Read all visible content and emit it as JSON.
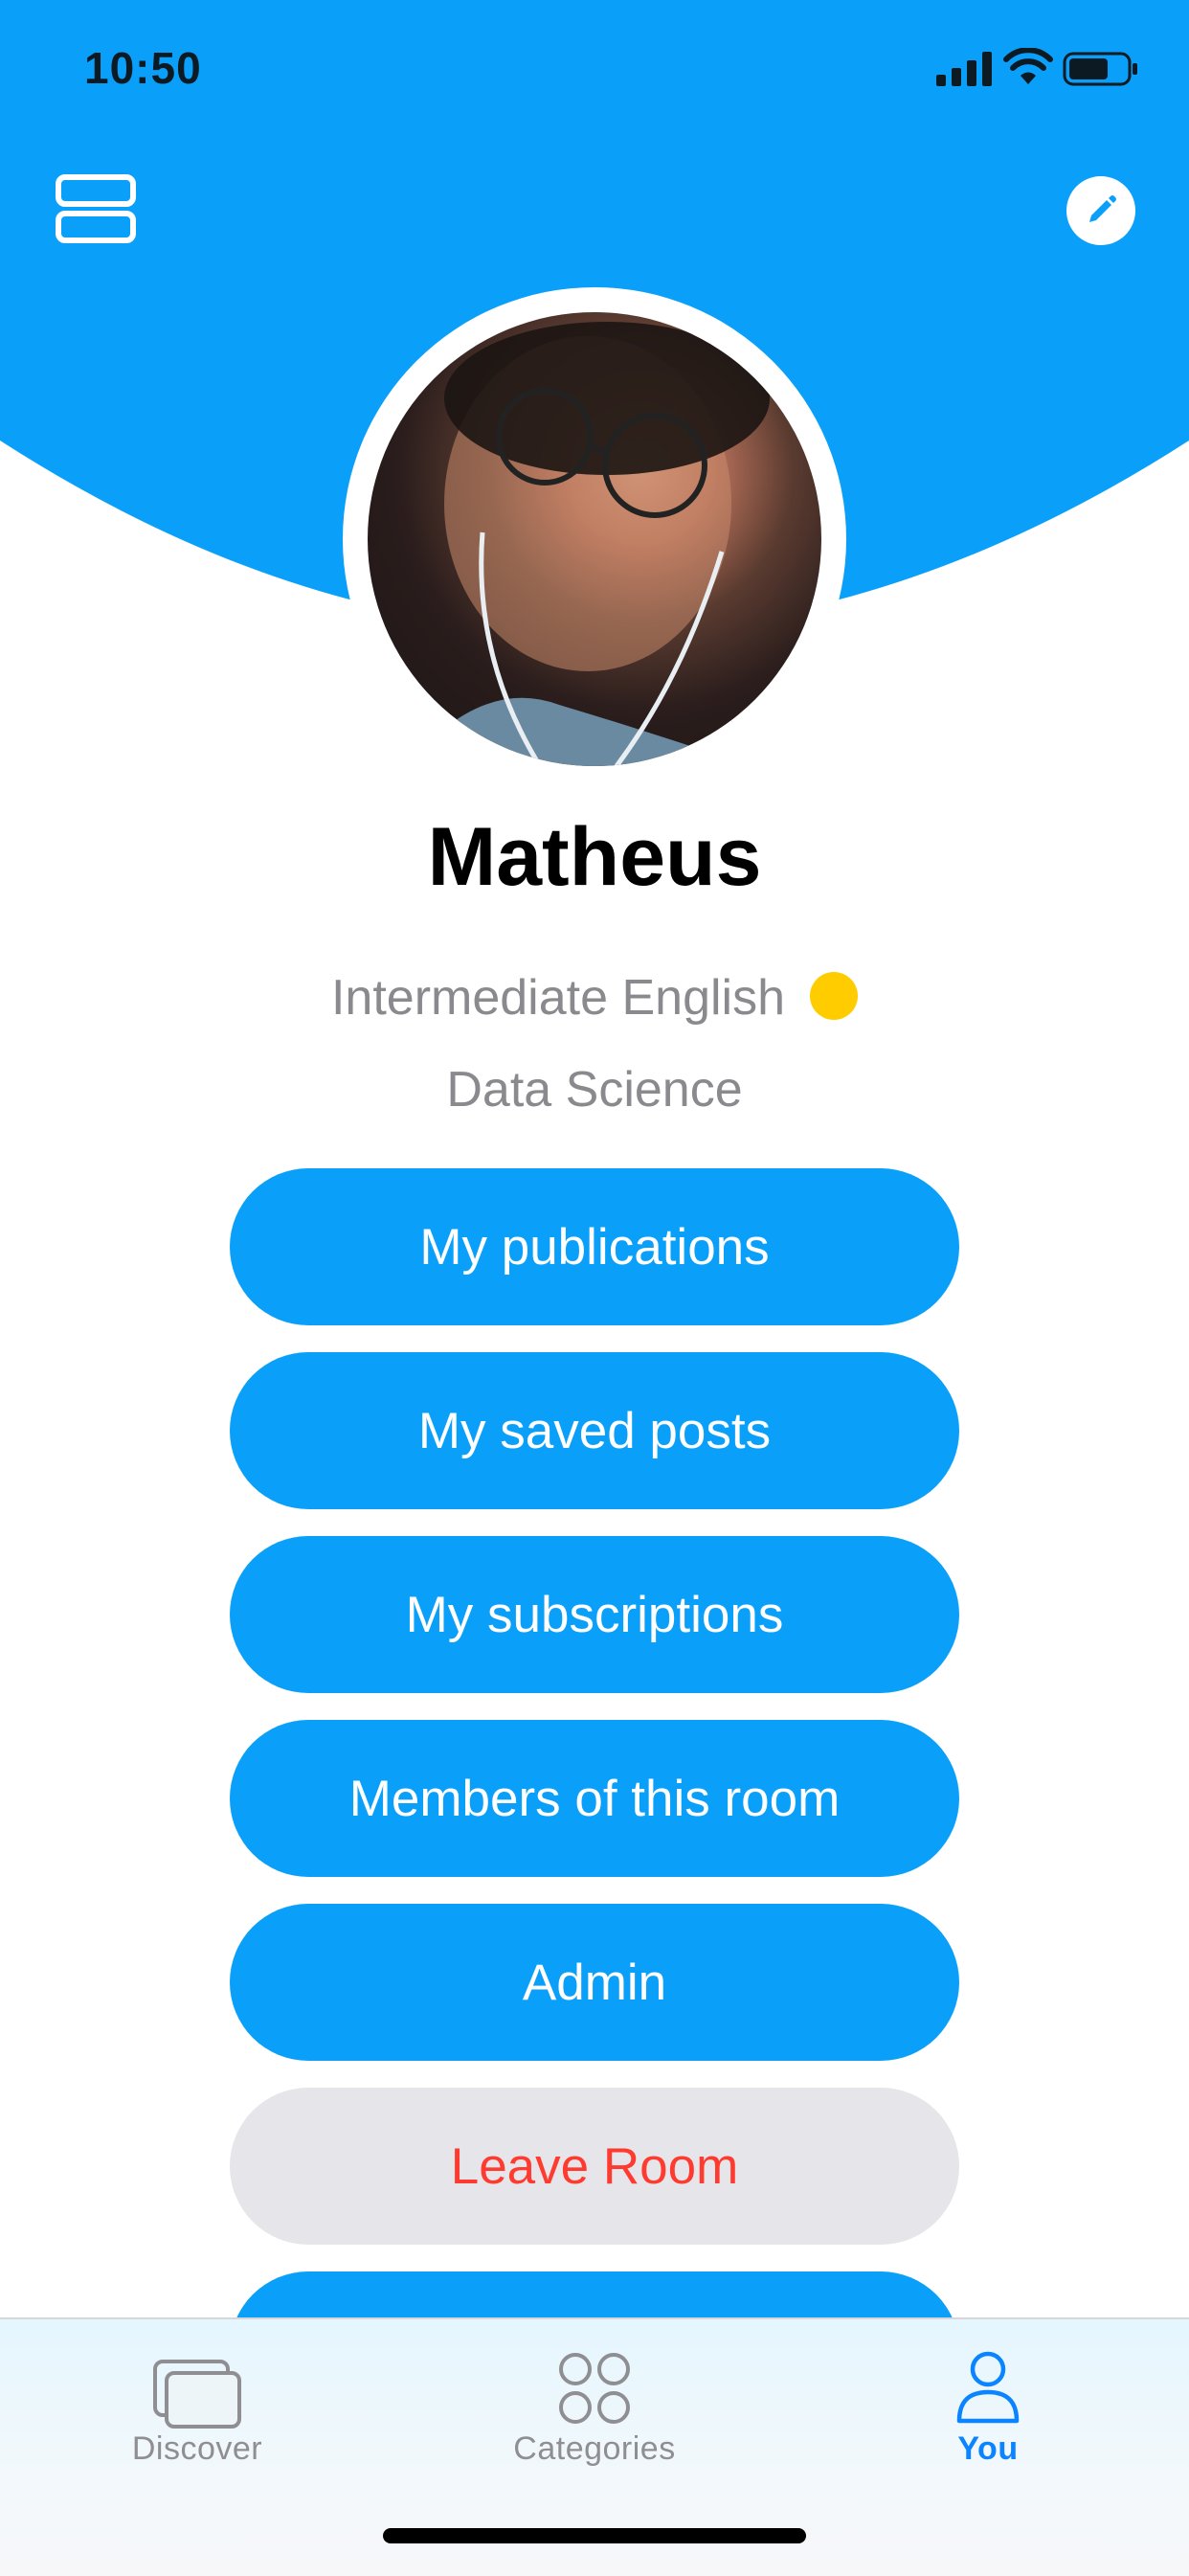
{
  "status_bar": {
    "time": "10:50"
  },
  "header": {
    "menu_icon": "list-view-icon",
    "edit_icon": "pencil-icon",
    "accent_color": "#0aa0fa"
  },
  "profile": {
    "name": "Matheus",
    "level": "Intermediate English",
    "level_color": "#ffcc00",
    "room": "Data Science"
  },
  "actions": [
    {
      "label": "My publications"
    },
    {
      "label": "My saved posts"
    },
    {
      "label": "My subscriptions"
    },
    {
      "label": "Members of this room"
    },
    {
      "label": "Admin"
    },
    {
      "label": "Leave Room",
      "color": "#ff3b30"
    }
  ],
  "tab_bar": {
    "tabs": [
      {
        "label": "Discover",
        "icon": "stacked-cards-icon",
        "active": false
      },
      {
        "label": "Categories",
        "icon": "four-circles-icon",
        "active": false
      },
      {
        "label": "You",
        "icon": "person-icon",
        "active": true
      }
    ],
    "active_color": "#0a84ff",
    "inactive_color": "#8e8e93"
  }
}
